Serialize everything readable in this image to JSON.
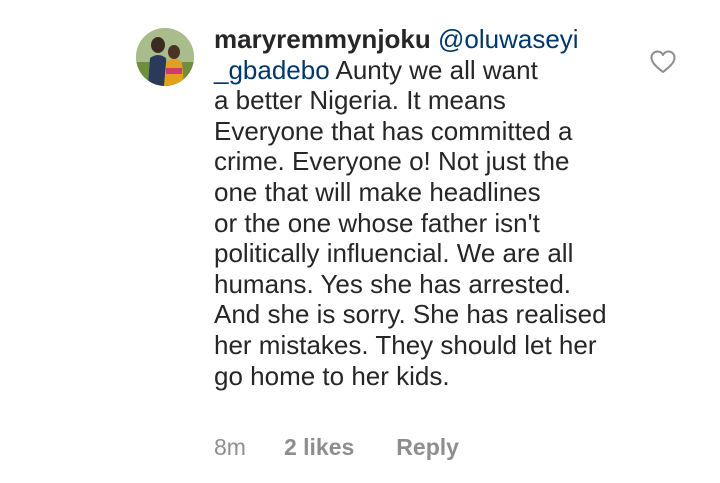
{
  "comment": {
    "username": "maryremmynjoku",
    "mention_part1": "@oluwaseyi",
    "mention_part2": "_gbadebo",
    "lines": [
      " Aunty we all want",
      "a better Nigeria. It means",
      "Everyone that has committed a",
      "crime. Everyone o! Not just the",
      "one that will make headlines",
      "or the one whose father isn't",
      "politically influencial. We are all",
      "humans. Yes she has arrested.",
      "And she is sorry. She has realised",
      "her mistakes. They should let her",
      "go home to her kids."
    ]
  },
  "meta": {
    "time": "8m",
    "likes": "2 likes",
    "reply": "Reply"
  },
  "icons": {
    "like": "heart-outline-icon"
  },
  "colors": {
    "text": "#262626",
    "mention": "#00376b",
    "secondary": "#8e8e8e"
  }
}
